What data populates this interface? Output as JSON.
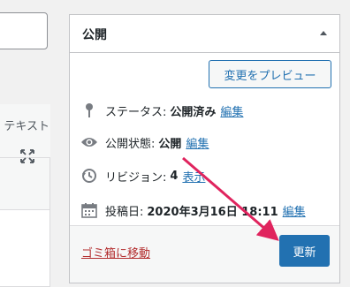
{
  "editor": {
    "text_tab": "テキスト",
    "fullscreen_icon": "fullscreen-icon"
  },
  "publish": {
    "title": "公開",
    "preview_button": "変更をプレビュー",
    "status": {
      "label": "ステータス:",
      "value": "公開済み",
      "edit": "編集",
      "icon": "pin-icon"
    },
    "visibility": {
      "label": "公開状態:",
      "value": "公開",
      "edit": "編集",
      "icon": "eye-icon"
    },
    "revisions": {
      "label": "リビジョン:",
      "value": "4",
      "edit": "表示",
      "icon": "history-icon"
    },
    "date": {
      "label": "投稿日:",
      "value": "2020年3月16日 18:11",
      "edit": "編集",
      "icon": "calendar-icon"
    },
    "trash_link": "ゴミ箱に移動",
    "update_button": "更新"
  },
  "colors": {
    "accent": "#2271b1",
    "danger": "#b32d2e",
    "annotation": "#e0245e"
  }
}
